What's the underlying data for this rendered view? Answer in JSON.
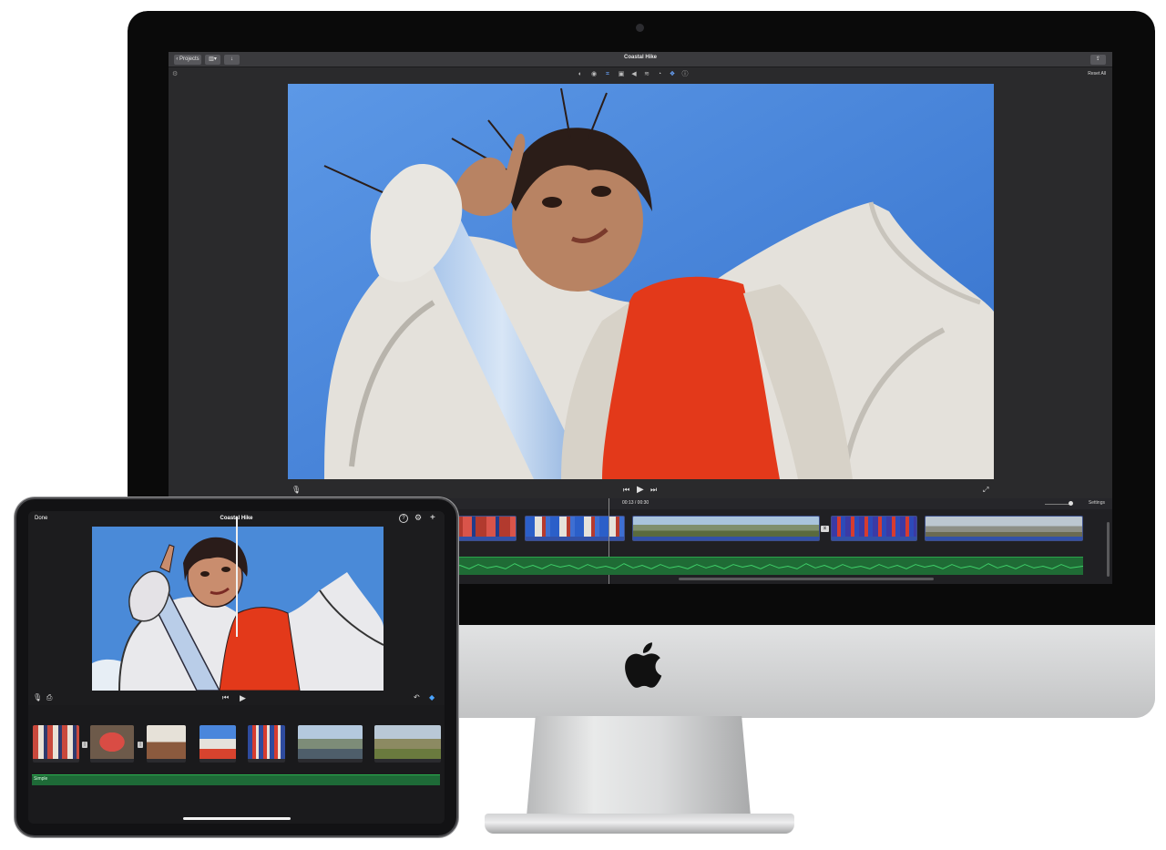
{
  "mac": {
    "title": "Coastal Hike",
    "back_label": "Projects",
    "reset_all": "Reset All",
    "timecode": "00:13 / 00:30",
    "settings_label": "Settings"
  },
  "ipad": {
    "done_label": "Done",
    "title": "Coastal Hike",
    "audio_label": "Simple"
  },
  "colors": {
    "sky": "#4a86dc",
    "jacket": "#e9e6e0",
    "shirt": "#e3391a",
    "audio_green": "#1f6b35",
    "clip_blue": "#3251a8"
  },
  "icons": {
    "toolbar": [
      "color-balance-icon",
      "color-correction-icon",
      "crop-icon",
      "stabilization-icon",
      "volume-icon",
      "noise-reduction-icon",
      "speed-icon",
      "clip-filter-icon",
      "info-icon"
    ]
  }
}
